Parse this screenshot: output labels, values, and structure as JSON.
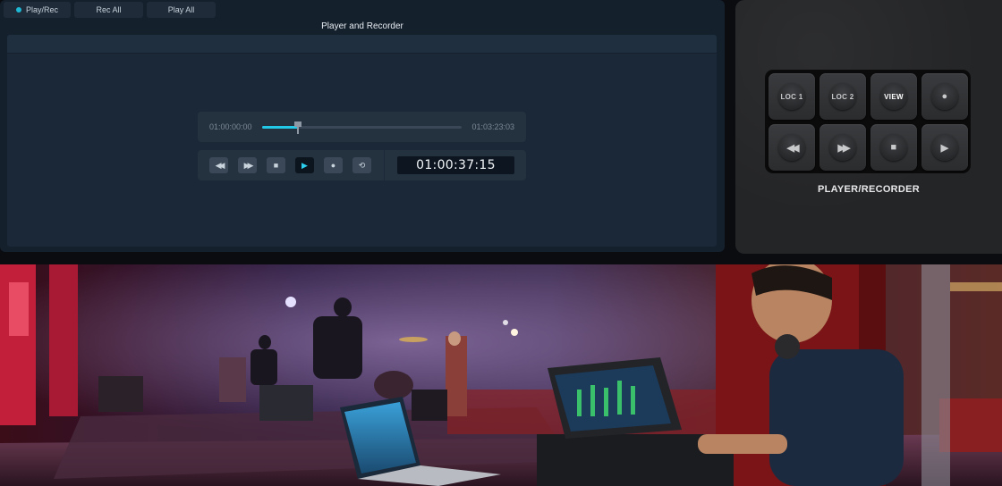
{
  "tabs": {
    "play_rec": "Play/Rec",
    "rec_all": "Rec All",
    "play_all": "Play All"
  },
  "panel": {
    "title": "Player and Recorder"
  },
  "transport": {
    "start_time": "01:00:00:00",
    "end_time": "01:03:23:03",
    "progress": 0.18,
    "timecode": "01:00:37:15",
    "buttons": [
      {
        "name": "rewind-button",
        "icon": "rewind-icon",
        "glyph": "◀◀",
        "active": false
      },
      {
        "name": "fast-forward-button",
        "icon": "fast-forward-icon",
        "glyph": "▶▶",
        "active": false
      },
      {
        "name": "stop-button",
        "icon": "stop-icon",
        "glyph": "■",
        "active": false
      },
      {
        "name": "play-button",
        "icon": "play-icon",
        "glyph": "▶",
        "active": true
      },
      {
        "name": "record-button",
        "icon": "record-icon",
        "glyph": "●",
        "active": false
      },
      {
        "name": "loop-button",
        "icon": "loop-icon",
        "glyph": "⟲",
        "active": false
      }
    ]
  },
  "hardware": {
    "label": "PLAYER/RECORDER",
    "keys": [
      {
        "name": "key-loc1",
        "label": "LOC 1"
      },
      {
        "name": "key-loc2",
        "label": "LOC 2"
      },
      {
        "name": "key-view",
        "label": "VIEW",
        "bright": true
      },
      {
        "name": "key-record",
        "icon": "record-icon",
        "glyph": "●"
      },
      {
        "name": "key-rewind",
        "icon": "rewind-icon",
        "glyph": "◀◀"
      },
      {
        "name": "key-fast-forward",
        "icon": "fast-forward-icon",
        "glyph": "▶▶"
      },
      {
        "name": "key-stop",
        "icon": "stop-icon",
        "glyph": "■"
      },
      {
        "name": "key-play",
        "icon": "play-icon",
        "glyph": "▶"
      }
    ]
  },
  "colors": {
    "accent": "#22c8e6",
    "panel_bg": "#15202d",
    "hardware_bg": "#242527"
  }
}
